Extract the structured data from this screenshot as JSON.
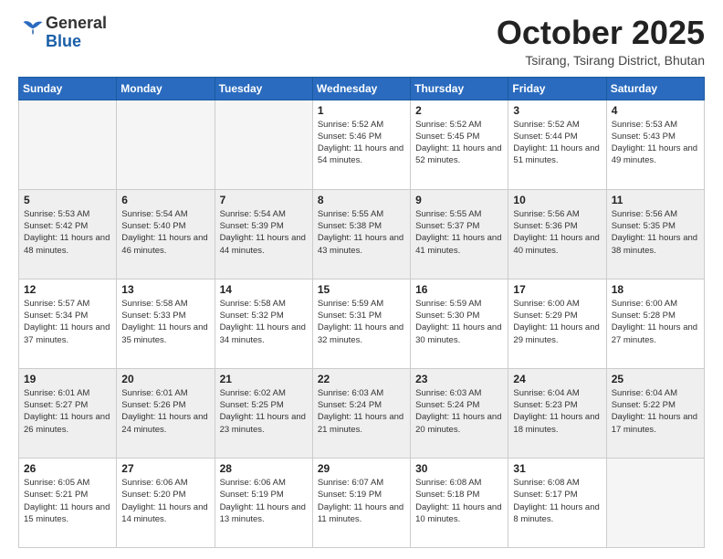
{
  "header": {
    "logo_general": "General",
    "logo_blue": "Blue",
    "month_title": "October 2025",
    "location": "Tsirang, Tsirang District, Bhutan"
  },
  "weekdays": [
    "Sunday",
    "Monday",
    "Tuesday",
    "Wednesday",
    "Thursday",
    "Friday",
    "Saturday"
  ],
  "weeks": [
    [
      {
        "day": "",
        "empty": true
      },
      {
        "day": "",
        "empty": true
      },
      {
        "day": "",
        "empty": true
      },
      {
        "day": "1",
        "sunrise": "5:52 AM",
        "sunset": "5:46 PM",
        "daylight": "11 hours and 54 minutes."
      },
      {
        "day": "2",
        "sunrise": "5:52 AM",
        "sunset": "5:45 PM",
        "daylight": "11 hours and 52 minutes."
      },
      {
        "day": "3",
        "sunrise": "5:52 AM",
        "sunset": "5:44 PM",
        "daylight": "11 hours and 51 minutes."
      },
      {
        "day": "4",
        "sunrise": "5:53 AM",
        "sunset": "5:43 PM",
        "daylight": "11 hours and 49 minutes."
      }
    ],
    [
      {
        "day": "5",
        "sunrise": "5:53 AM",
        "sunset": "5:42 PM",
        "daylight": "11 hours and 48 minutes."
      },
      {
        "day": "6",
        "sunrise": "5:54 AM",
        "sunset": "5:40 PM",
        "daylight": "11 hours and 46 minutes."
      },
      {
        "day": "7",
        "sunrise": "5:54 AM",
        "sunset": "5:39 PM",
        "daylight": "11 hours and 44 minutes."
      },
      {
        "day": "8",
        "sunrise": "5:55 AM",
        "sunset": "5:38 PM",
        "daylight": "11 hours and 43 minutes."
      },
      {
        "day": "9",
        "sunrise": "5:55 AM",
        "sunset": "5:37 PM",
        "daylight": "11 hours and 41 minutes."
      },
      {
        "day": "10",
        "sunrise": "5:56 AM",
        "sunset": "5:36 PM",
        "daylight": "11 hours and 40 minutes."
      },
      {
        "day": "11",
        "sunrise": "5:56 AM",
        "sunset": "5:35 PM",
        "daylight": "11 hours and 38 minutes."
      }
    ],
    [
      {
        "day": "12",
        "sunrise": "5:57 AM",
        "sunset": "5:34 PM",
        "daylight": "11 hours and 37 minutes."
      },
      {
        "day": "13",
        "sunrise": "5:58 AM",
        "sunset": "5:33 PM",
        "daylight": "11 hours and 35 minutes."
      },
      {
        "day": "14",
        "sunrise": "5:58 AM",
        "sunset": "5:32 PM",
        "daylight": "11 hours and 34 minutes."
      },
      {
        "day": "15",
        "sunrise": "5:59 AM",
        "sunset": "5:31 PM",
        "daylight": "11 hours and 32 minutes."
      },
      {
        "day": "16",
        "sunrise": "5:59 AM",
        "sunset": "5:30 PM",
        "daylight": "11 hours and 30 minutes."
      },
      {
        "day": "17",
        "sunrise": "6:00 AM",
        "sunset": "5:29 PM",
        "daylight": "11 hours and 29 minutes."
      },
      {
        "day": "18",
        "sunrise": "6:00 AM",
        "sunset": "5:28 PM",
        "daylight": "11 hours and 27 minutes."
      }
    ],
    [
      {
        "day": "19",
        "sunrise": "6:01 AM",
        "sunset": "5:27 PM",
        "daylight": "11 hours and 26 minutes."
      },
      {
        "day": "20",
        "sunrise": "6:01 AM",
        "sunset": "5:26 PM",
        "daylight": "11 hours and 24 minutes."
      },
      {
        "day": "21",
        "sunrise": "6:02 AM",
        "sunset": "5:25 PM",
        "daylight": "11 hours and 23 minutes."
      },
      {
        "day": "22",
        "sunrise": "6:03 AM",
        "sunset": "5:24 PM",
        "daylight": "11 hours and 21 minutes."
      },
      {
        "day": "23",
        "sunrise": "6:03 AM",
        "sunset": "5:24 PM",
        "daylight": "11 hours and 20 minutes."
      },
      {
        "day": "24",
        "sunrise": "6:04 AM",
        "sunset": "5:23 PM",
        "daylight": "11 hours and 18 minutes."
      },
      {
        "day": "25",
        "sunrise": "6:04 AM",
        "sunset": "5:22 PM",
        "daylight": "11 hours and 17 minutes."
      }
    ],
    [
      {
        "day": "26",
        "sunrise": "6:05 AM",
        "sunset": "5:21 PM",
        "daylight": "11 hours and 15 minutes."
      },
      {
        "day": "27",
        "sunrise": "6:06 AM",
        "sunset": "5:20 PM",
        "daylight": "11 hours and 14 minutes."
      },
      {
        "day": "28",
        "sunrise": "6:06 AM",
        "sunset": "5:19 PM",
        "daylight": "11 hours and 13 minutes."
      },
      {
        "day": "29",
        "sunrise": "6:07 AM",
        "sunset": "5:19 PM",
        "daylight": "11 hours and 11 minutes."
      },
      {
        "day": "30",
        "sunrise": "6:08 AM",
        "sunset": "5:18 PM",
        "daylight": "11 hours and 10 minutes."
      },
      {
        "day": "31",
        "sunrise": "6:08 AM",
        "sunset": "5:17 PM",
        "daylight": "11 hours and 8 minutes."
      },
      {
        "day": "",
        "empty": true
      }
    ]
  ],
  "labels": {
    "sunrise": "Sunrise:",
    "sunset": "Sunset:",
    "daylight": "Daylight hours"
  }
}
